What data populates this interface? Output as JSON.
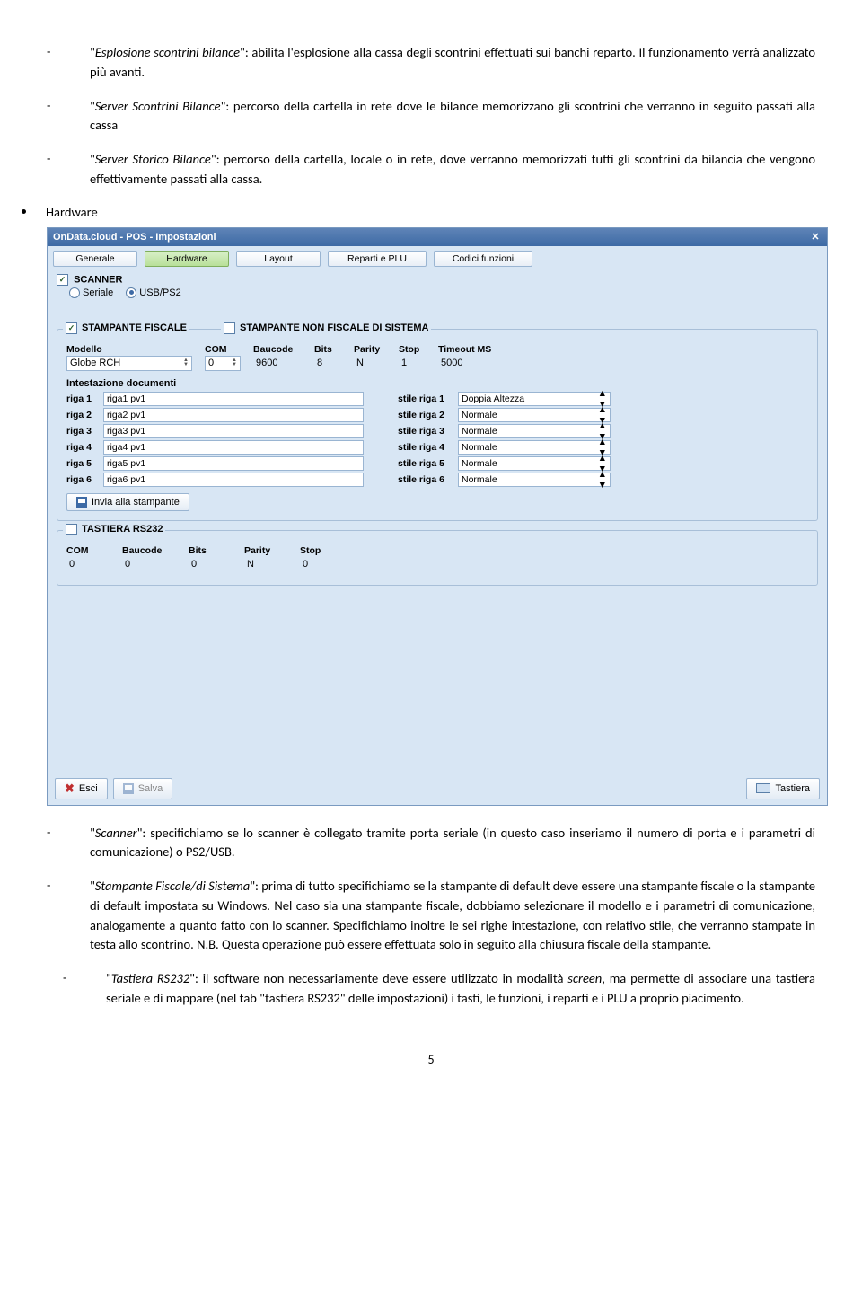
{
  "intro": {
    "item1_title": "Esplosione scontrini bilance",
    "item1_text": ": abilita l'esplosione alla cassa degli scontrini effettuati sui banchi reparto. Il funzionamento verrà analizzato più avanti.",
    "item2_title": "Server Scontrini Bilance",
    "item2_text": ": percorso della cartella in rete dove le bilance memorizzano gli scontrini che verranno in seguito passati alla cassa",
    "item3_title": "Server Storico Bilance",
    "item3_text": ": percorso della cartella, locale o in rete, dove verranno memorizzati tutti gli scontrini da bilancia che vengono effettivamente passati alla cassa."
  },
  "hw_label": "Hardware",
  "win": {
    "title": "OnData.cloud  -  POS  -  Impostazioni",
    "tabs": {
      "generale": "Generale",
      "hardware": "Hardware",
      "layout": "Layout",
      "reparti": "Reparti e PLU",
      "codici": "Codici funzioni"
    },
    "scanner": {
      "title": "SCANNER",
      "opt1": "Seriale",
      "opt2": "USB/PS2"
    },
    "stamp": {
      "title1": "STAMPANTE FISCALE",
      "title2": "STAMPANTE NON FISCALE DI SISTEMA",
      "modello_lbl": "Modello",
      "modello_val": "Globe RCH",
      "com_lbl": "COM",
      "com_val": "0",
      "baucode_lbl": "Baucode",
      "baucode_val": "9600",
      "bits_lbl": "Bits",
      "bits_val": "8",
      "parity_lbl": "Parity",
      "parity_val": "N",
      "stop_lbl": "Stop",
      "stop_val": "1",
      "timeout_lbl": "Timeout MS",
      "timeout_val": "5000",
      "intest": "Intestazione documenti",
      "rows": [
        {
          "lbl": "riga 1",
          "val": "riga1 pv1",
          "slbl": "stile riga 1",
          "sval": "Doppia Altezza"
        },
        {
          "lbl": "riga 2",
          "val": "riga2 pv1",
          "slbl": "stile riga 2",
          "sval": "Normale"
        },
        {
          "lbl": "riga 3",
          "val": "riga3 pv1",
          "slbl": "stile riga 3",
          "sval": "Normale"
        },
        {
          "lbl": "riga 4",
          "val": "riga4 pv1",
          "slbl": "stile riga 4",
          "sval": "Normale"
        },
        {
          "lbl": "riga 5",
          "val": "riga5 pv1",
          "slbl": "stile riga 5",
          "sval": "Normale"
        },
        {
          "lbl": "riga 6",
          "val": "riga6 pv1",
          "slbl": "stile riga 6",
          "sval": "Normale"
        }
      ],
      "invia": "Invia alla stampante"
    },
    "tastiera": {
      "title": "TASTIERA RS232",
      "com_lbl": "COM",
      "com_val": "0",
      "baucode_lbl": "Baucode",
      "baucode_val": "0",
      "bits_lbl": "Bits",
      "bits_val": "0",
      "parity_lbl": "Parity",
      "parity_val": "N",
      "stop_lbl": "Stop",
      "stop_val": "0"
    },
    "footer": {
      "esci": "Esci",
      "salva": "Salva",
      "tastiera": "Tastiera"
    }
  },
  "post": {
    "scanner_title": "Scanner",
    "scanner_text": ": specifichiamo se lo scanner è collegato tramite porta seriale (in questo caso inseriamo il numero di porta e  i parametri di comunicazione) o PS2/USB.",
    "stamp_title": "Stampante Fiscale/di Sistema",
    "stamp_text": ": prima di tutto specifichiamo se la stampante di default deve essere una stampante fiscale o la stampante di default impostata su Windows. Nel caso sia una stampante fiscale, dobbiamo selezionare il modello e i parametri di comunicazione, analogamente a quanto fatto con lo scanner. Specifichiamo inoltre le sei righe intestazione, con relativo stile, che verranno stampate in testa allo scontrino. N.B. Questa operazione può essere effettuata solo in seguito alla chiusura fiscale della stampante.",
    "tast_title": "Tastiera RS232",
    "tast_text_a": ": il software non necessariamente deve essere utilizzato in modalità ",
    "tast_text_ital": "screen",
    "tast_text_b": ", ma permette di associare una tastiera seriale e di mappare (nel tab \"tastiera RS232\" delle impostazioni) i tasti, le funzioni, i reparti e i PLU a proprio piacimento."
  },
  "page": "5"
}
